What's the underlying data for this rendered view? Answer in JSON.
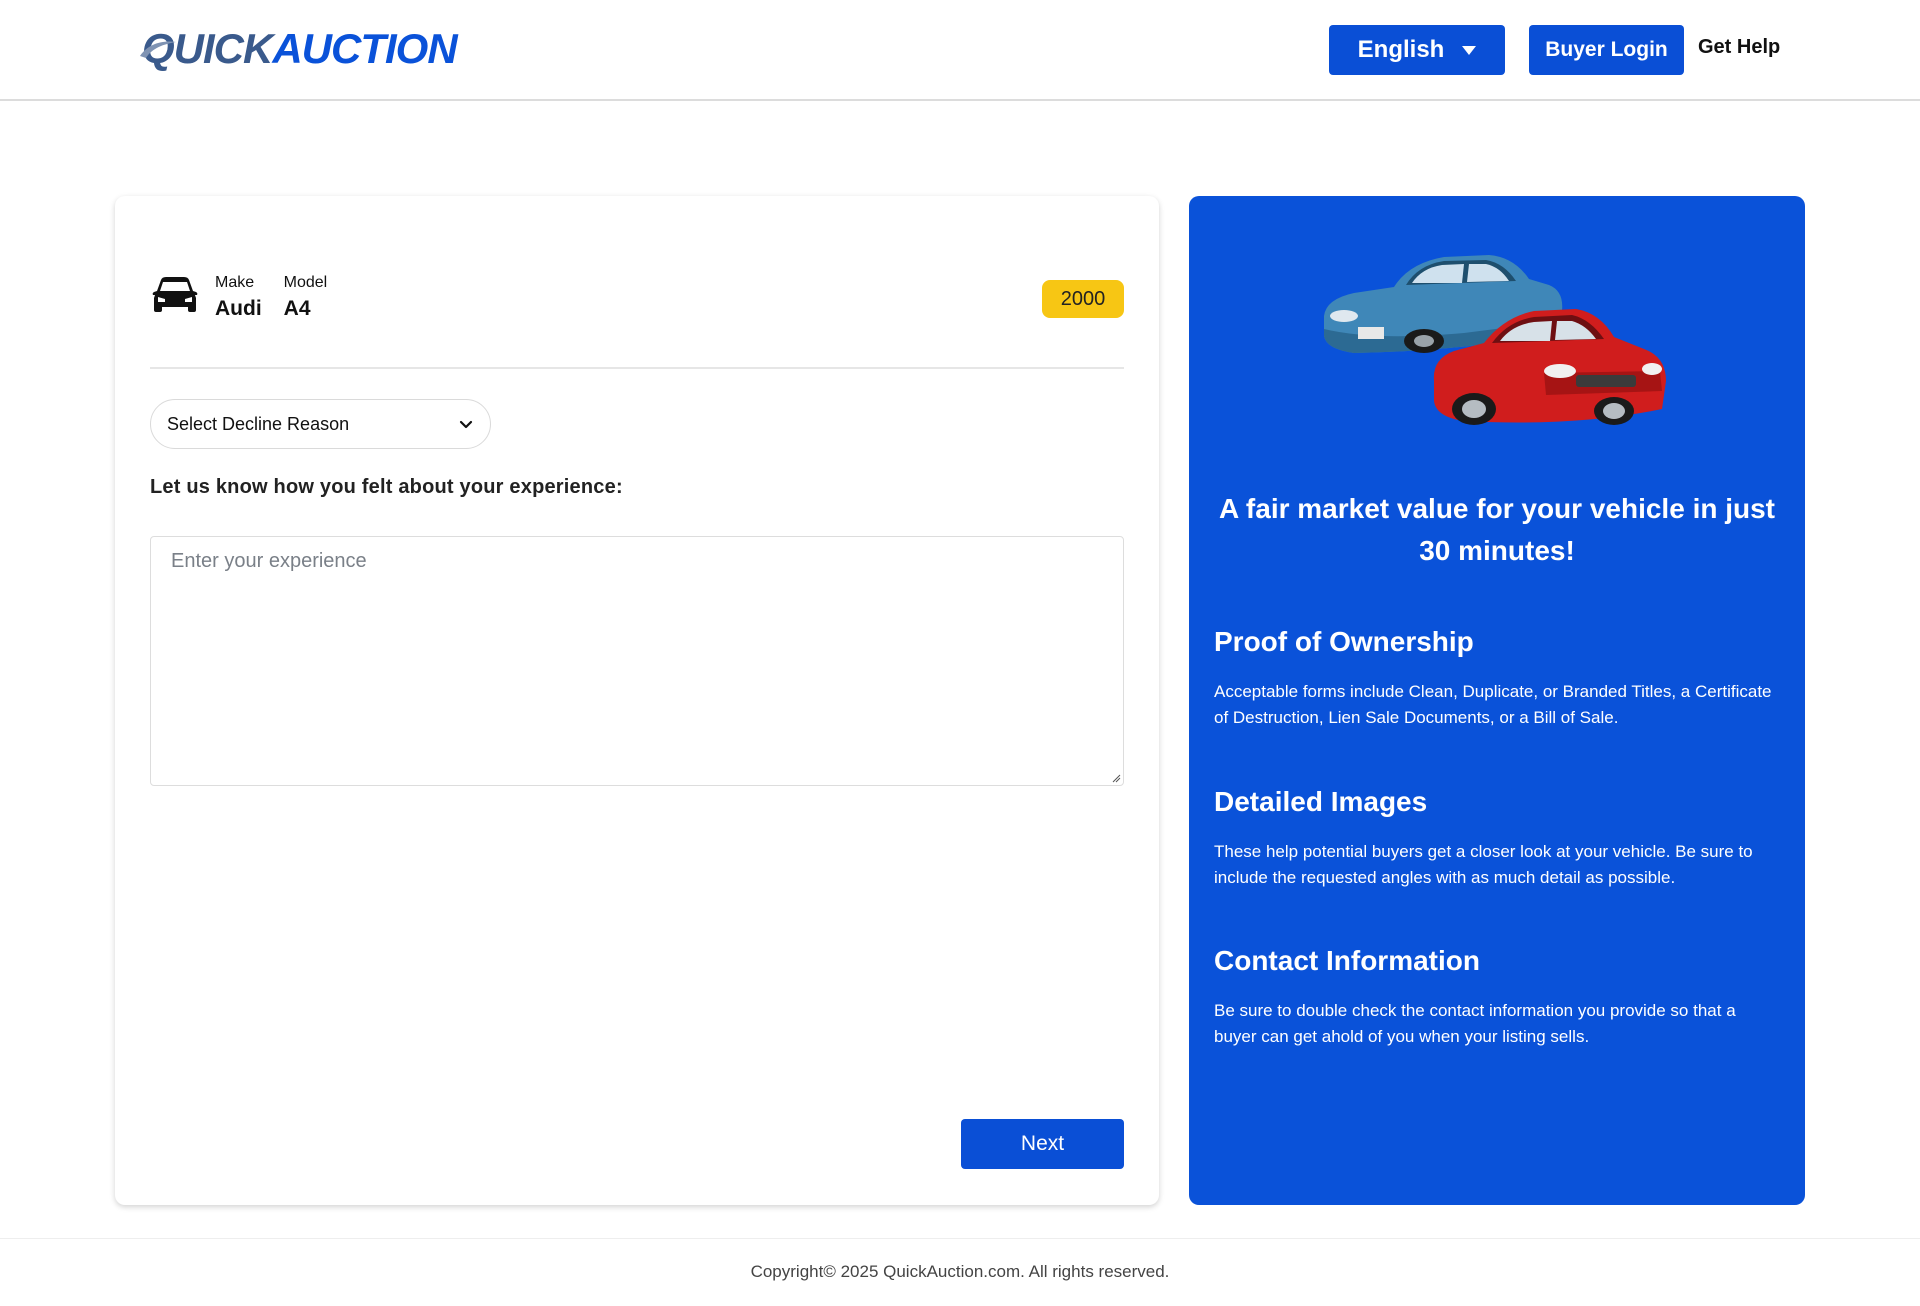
{
  "header": {
    "logo_quick": "QUICK",
    "logo_auction": "AUCTION",
    "language_label": "English",
    "buyer_login_label": "Buyer Login",
    "get_help_label": "Get Help"
  },
  "vehicle": {
    "make_label": "Make",
    "make_value": "Audi",
    "model_label": "Model",
    "model_value": "A4",
    "year": "2000",
    "icon": "car-icon"
  },
  "form": {
    "decline_select_value": "Select Decline Reason",
    "experience_question": "Let us know how you felt about your experience:",
    "experience_placeholder": "Enter your experience",
    "next_label": "Next"
  },
  "panel": {
    "title": "A fair market value for your vehicle in just 30 minutes!",
    "sections": [
      {
        "heading": "Proof of Ownership",
        "text": "Acceptable forms include Clean, Duplicate, or Branded Titles, a Certificate of Destruction, Lien Sale Documents, or a Bill of Sale."
      },
      {
        "heading": "Detailed Images",
        "text": "These help potential buyers get a closer look at your vehicle. Be sure to include the requested angles with as much detail as possible."
      },
      {
        "heading": "Contact Information",
        "text": "Be sure to double check the contact information you provide so that a buyer can get ahold of you when your listing sells."
      }
    ]
  },
  "footer": {
    "copyright": "Copyright© 2025 QuickAuction.com. All rights reserved."
  },
  "colors": {
    "brand_blue": "#0a52d9",
    "button_blue": "#0a4fd6",
    "year_badge": "#f7c614"
  }
}
